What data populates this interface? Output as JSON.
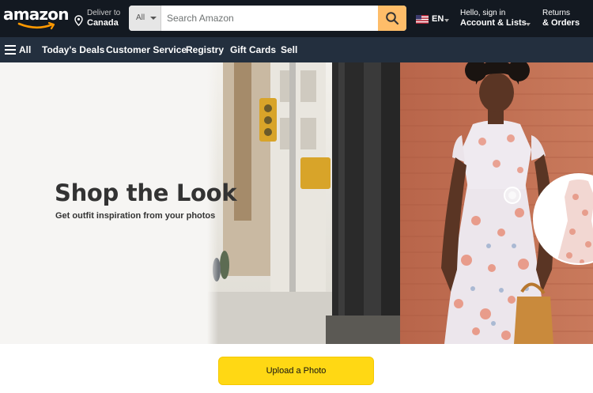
{
  "header": {
    "logo_text": "amazon",
    "deliver": {
      "line1": "Deliver to",
      "line2": "Canada"
    },
    "search": {
      "category": "All",
      "placeholder": "Search Amazon"
    },
    "language": {
      "code": "EN"
    },
    "account": {
      "line1": "Hello, sign in",
      "line2": "Account & Lists"
    },
    "orders": {
      "line1": "Returns",
      "line2": "& Orders"
    }
  },
  "subnav": {
    "all_label": "All",
    "items": [
      "Today's Deals",
      "Customer Service",
      "Registry",
      "Gift Cards",
      "Sell"
    ]
  },
  "hero": {
    "title": "Shop the Look",
    "subtitle": "Get outfit inspiration from your photos"
  },
  "actions": {
    "upload_label": "Upload a Photo"
  },
  "colors": {
    "nav_dark": "#131921",
    "subnav": "#232f3e",
    "search_button": "#febd69",
    "upload_button": "#ffd814",
    "logo_smile": "#ff9900"
  },
  "icons": [
    "location-pin-icon",
    "caret-down-icon",
    "search-icon",
    "us-flag-icon",
    "hamburger-menu-icon"
  ]
}
